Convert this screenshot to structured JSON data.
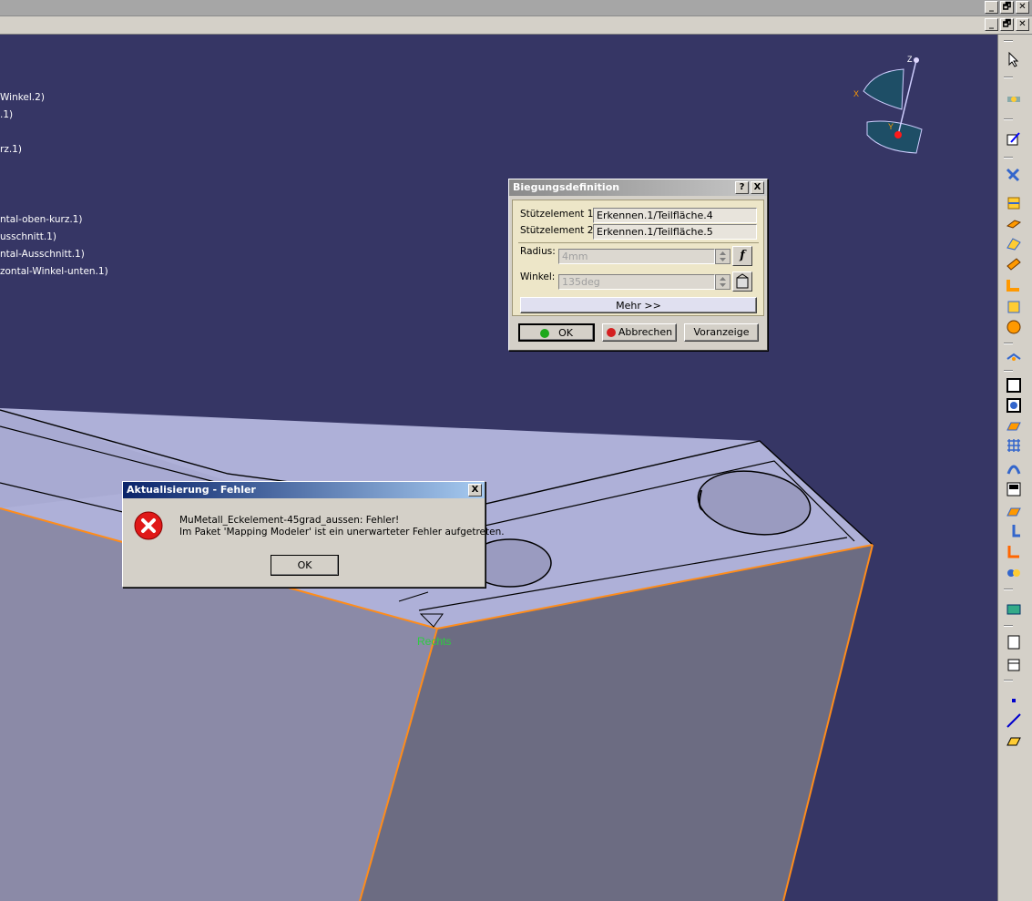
{
  "window_controls": {
    "minimize": "_",
    "restore": "🗗",
    "close": "✕"
  },
  "tree_items": [
    "Winkel.2)",
    ".1)",
    "rz.1)",
    "ntal-oben-kurz.1)",
    "usschnitt.1)",
    "ntal-Ausschnitt.1)",
    "zontal-Winkel-unten.1)"
  ],
  "compass": {
    "x": "X",
    "y": "Y",
    "z": "Z"
  },
  "scene_label": "Rechts",
  "bend_dialog": {
    "title": "Biegungsdefinition",
    "help": "?",
    "close": "X",
    "support1_label": "Stützelement 1:",
    "support1_value": "Erkennen.1/Teilfläche.4",
    "support2_label": "Stützelement 2:",
    "support2_value": "Erkennen.1/Teilfläche.5",
    "radius_label": "Radius:",
    "radius_value": "4mm",
    "angle_label": "Winkel:",
    "angle_value": "135deg",
    "more_button": "Mehr >>",
    "ok_button": "OK",
    "cancel_button": "Abbrechen",
    "preview_button": "Voranzeige"
  },
  "error_dialog": {
    "title": "Aktualisierung - Fehler",
    "close": "X",
    "line1": "MuMetall_Eckelement-45grad_aussen: Fehler!",
    "line2": "Im Paket 'Mapping Modeler' ist ein unerwarteter Fehler aufgetreten.",
    "ok_button": "OK"
  },
  "colors": {
    "background": "#363665",
    "part_top": "#aeb0d8",
    "part_front": "#8a8aa6",
    "part_right": "#6b6b80",
    "edge_highlight": "#ff8c1a",
    "label_green": "#2ecc40"
  }
}
